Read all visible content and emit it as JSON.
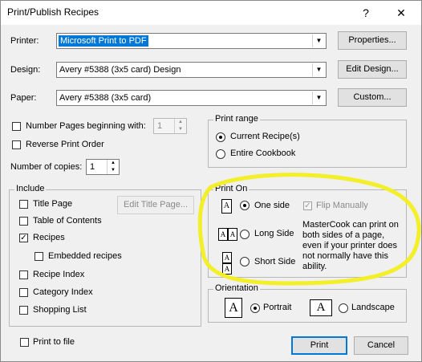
{
  "window": {
    "title": "Print/Publish Recipes",
    "help_glyph": "?",
    "close_glyph": "✕"
  },
  "printer": {
    "label": "Printer:",
    "value": "Microsoft Print to PDF",
    "button": "Properties..."
  },
  "design": {
    "label": "Design:",
    "value": "Avery #5388 (3x5 card) Design",
    "button": "Edit Design..."
  },
  "paper": {
    "label": "Paper:",
    "value": "Avery #5388 (3x5 card)",
    "button": "Custom..."
  },
  "options": {
    "number_pages_label": "Number Pages beginning with:",
    "number_pages_value": "1",
    "reverse_label": "Reverse Print Order",
    "copies_label": "Number of copies:",
    "copies_value": "1"
  },
  "print_range": {
    "title": "Print range",
    "current": "Current Recipe(s)",
    "entire": "Entire Cookbook"
  },
  "include": {
    "title": "Include",
    "title_page": "Title Page",
    "edit_title_page": "Edit Title Page...",
    "toc": "Table of Contents",
    "recipes": "Recipes",
    "embedded": "Embedded recipes",
    "recipe_index": "Recipe Index",
    "category_index": "Category Index",
    "shopping_list": "Shopping List"
  },
  "print_on": {
    "title": "Print On",
    "one_side": "One side",
    "long_side": "Long Side",
    "short_side": "Short Side",
    "flip_manually": "Flip Manually",
    "note": "MasterCook can print on both sides of a page, even if your printer does not normally have this ability."
  },
  "orientation": {
    "title": "Orientation",
    "portrait": "Portrait",
    "landscape": "Landscape"
  },
  "footer": {
    "print_to_file": "Print to file",
    "print": "Print",
    "cancel": "Cancel"
  },
  "icons": {
    "doc_letter": "A",
    "check_mark": "✓",
    "dropdown": "▼",
    "spin_up": "▲",
    "spin_down": "▼"
  },
  "colors": {
    "selection": "#0078d7",
    "highlight_annotation": "#f2ee1c"
  }
}
